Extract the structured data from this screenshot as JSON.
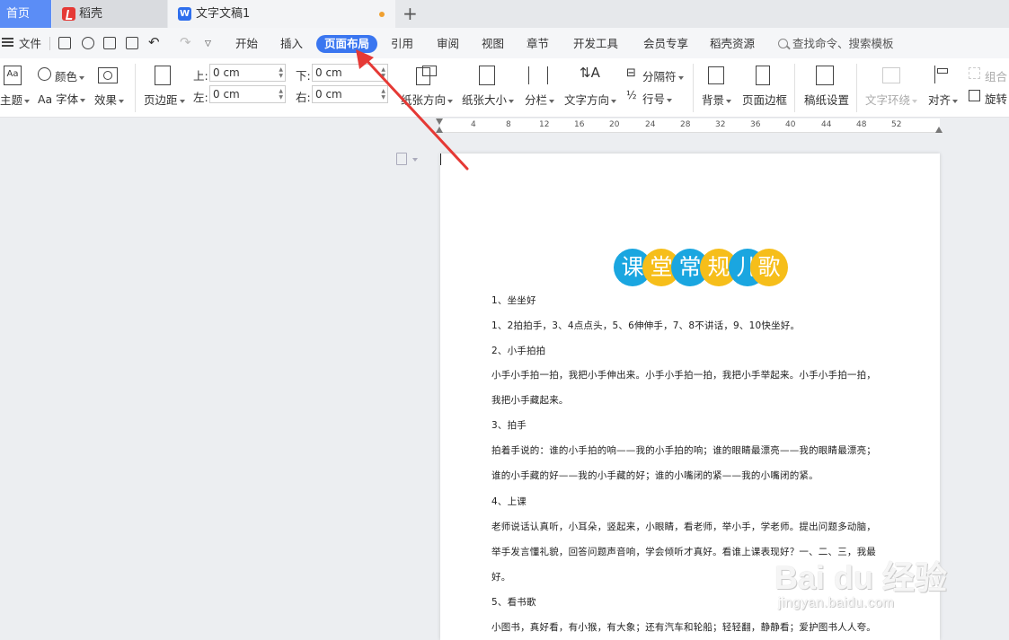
{
  "tabs": {
    "home": "首页",
    "daoke": "稻壳",
    "doc": "文字文稿1",
    "wps_logo": "W",
    "new_tab": "+"
  },
  "menu": {
    "file": "文件",
    "items": [
      "开始",
      "插入",
      "页面布局",
      "引用",
      "审阅",
      "视图",
      "章节",
      "开发工具",
      "会员专享",
      "稻壳资源"
    ],
    "search_placeholder": "查找命令、搜索模板"
  },
  "ribbon": {
    "theme": "主题",
    "theme_icon_text": "Aa",
    "color": "颜色",
    "font": "Aa 字体",
    "effect": "效果",
    "margins": "页边距",
    "top_label": "上:",
    "top_value": "0 cm",
    "bottom_label": "下:",
    "bottom_value": "0 cm",
    "left_label": "左:",
    "left_value": "0 cm",
    "right_label": "右:",
    "right_value": "0 cm",
    "orientation": "纸张方向",
    "size": "纸张大小",
    "columns": "分栏",
    "text_direction": "文字方向",
    "separator": "分隔符",
    "line_number": "行号",
    "background": "背景",
    "page_border": "页面边框",
    "paper_setting": "稿纸设置",
    "text_wrap": "文字环绕",
    "align": "对齐",
    "group": "组合",
    "rotate": "旋转"
  },
  "ruler": {
    "ticks": [
      "4",
      "8",
      "12",
      "16",
      "20",
      "24",
      "28",
      "32",
      "36",
      "40",
      "44",
      "48",
      "52"
    ]
  },
  "document": {
    "title_chars": [
      "课",
      "堂",
      "常",
      "规",
      "儿",
      "歌"
    ],
    "title_colors": [
      "#1aa6e0",
      "#f6be1a",
      "#1aa6e0",
      "#f6be1a",
      "#1aa6e0",
      "#f6be1a"
    ],
    "lines": [
      "1、坐坐好",
      "1、2拍拍手，3、4点点头，5、6伸伸手，7、8不讲话，9、10快坐好。",
      "2、小手拍拍",
      "小手小手拍一拍，我把小手伸出来。小手小手拍一拍，我把小手举起来。小手小手拍一拍，",
      "我把小手藏起来。",
      "3、拍手",
      "拍着手说的：谁的小手拍的响——我的小手拍的响；谁的眼睛最漂亮——我的眼睛最漂亮；",
      "谁的小手藏的好——我的小手藏的好；谁的小嘴闭的紧——我的小嘴闭的紧。",
      "4、上课",
      "老师说话认真听，小耳朵，竖起来，小眼睛，看老师，举小手，学老师。提出问题多动脑，",
      "举手发言懂礼貌，回答问题声音响，学会倾听才真好。看谁上课表现好？一、二、三，我最",
      "好。",
      "5、看书歌",
      "小图书，真好看，有小猴，有大象；还有汽车和轮船；轻轻翻，静静看；爱护图书人人夸。"
    ]
  },
  "watermark": {
    "line1": "Bai du 经验",
    "line2": "jingyan.baidu.com"
  },
  "colors": {
    "accent": "#3a76f0",
    "home_tab": "#5b8df6",
    "arrow": "#e53935"
  }
}
